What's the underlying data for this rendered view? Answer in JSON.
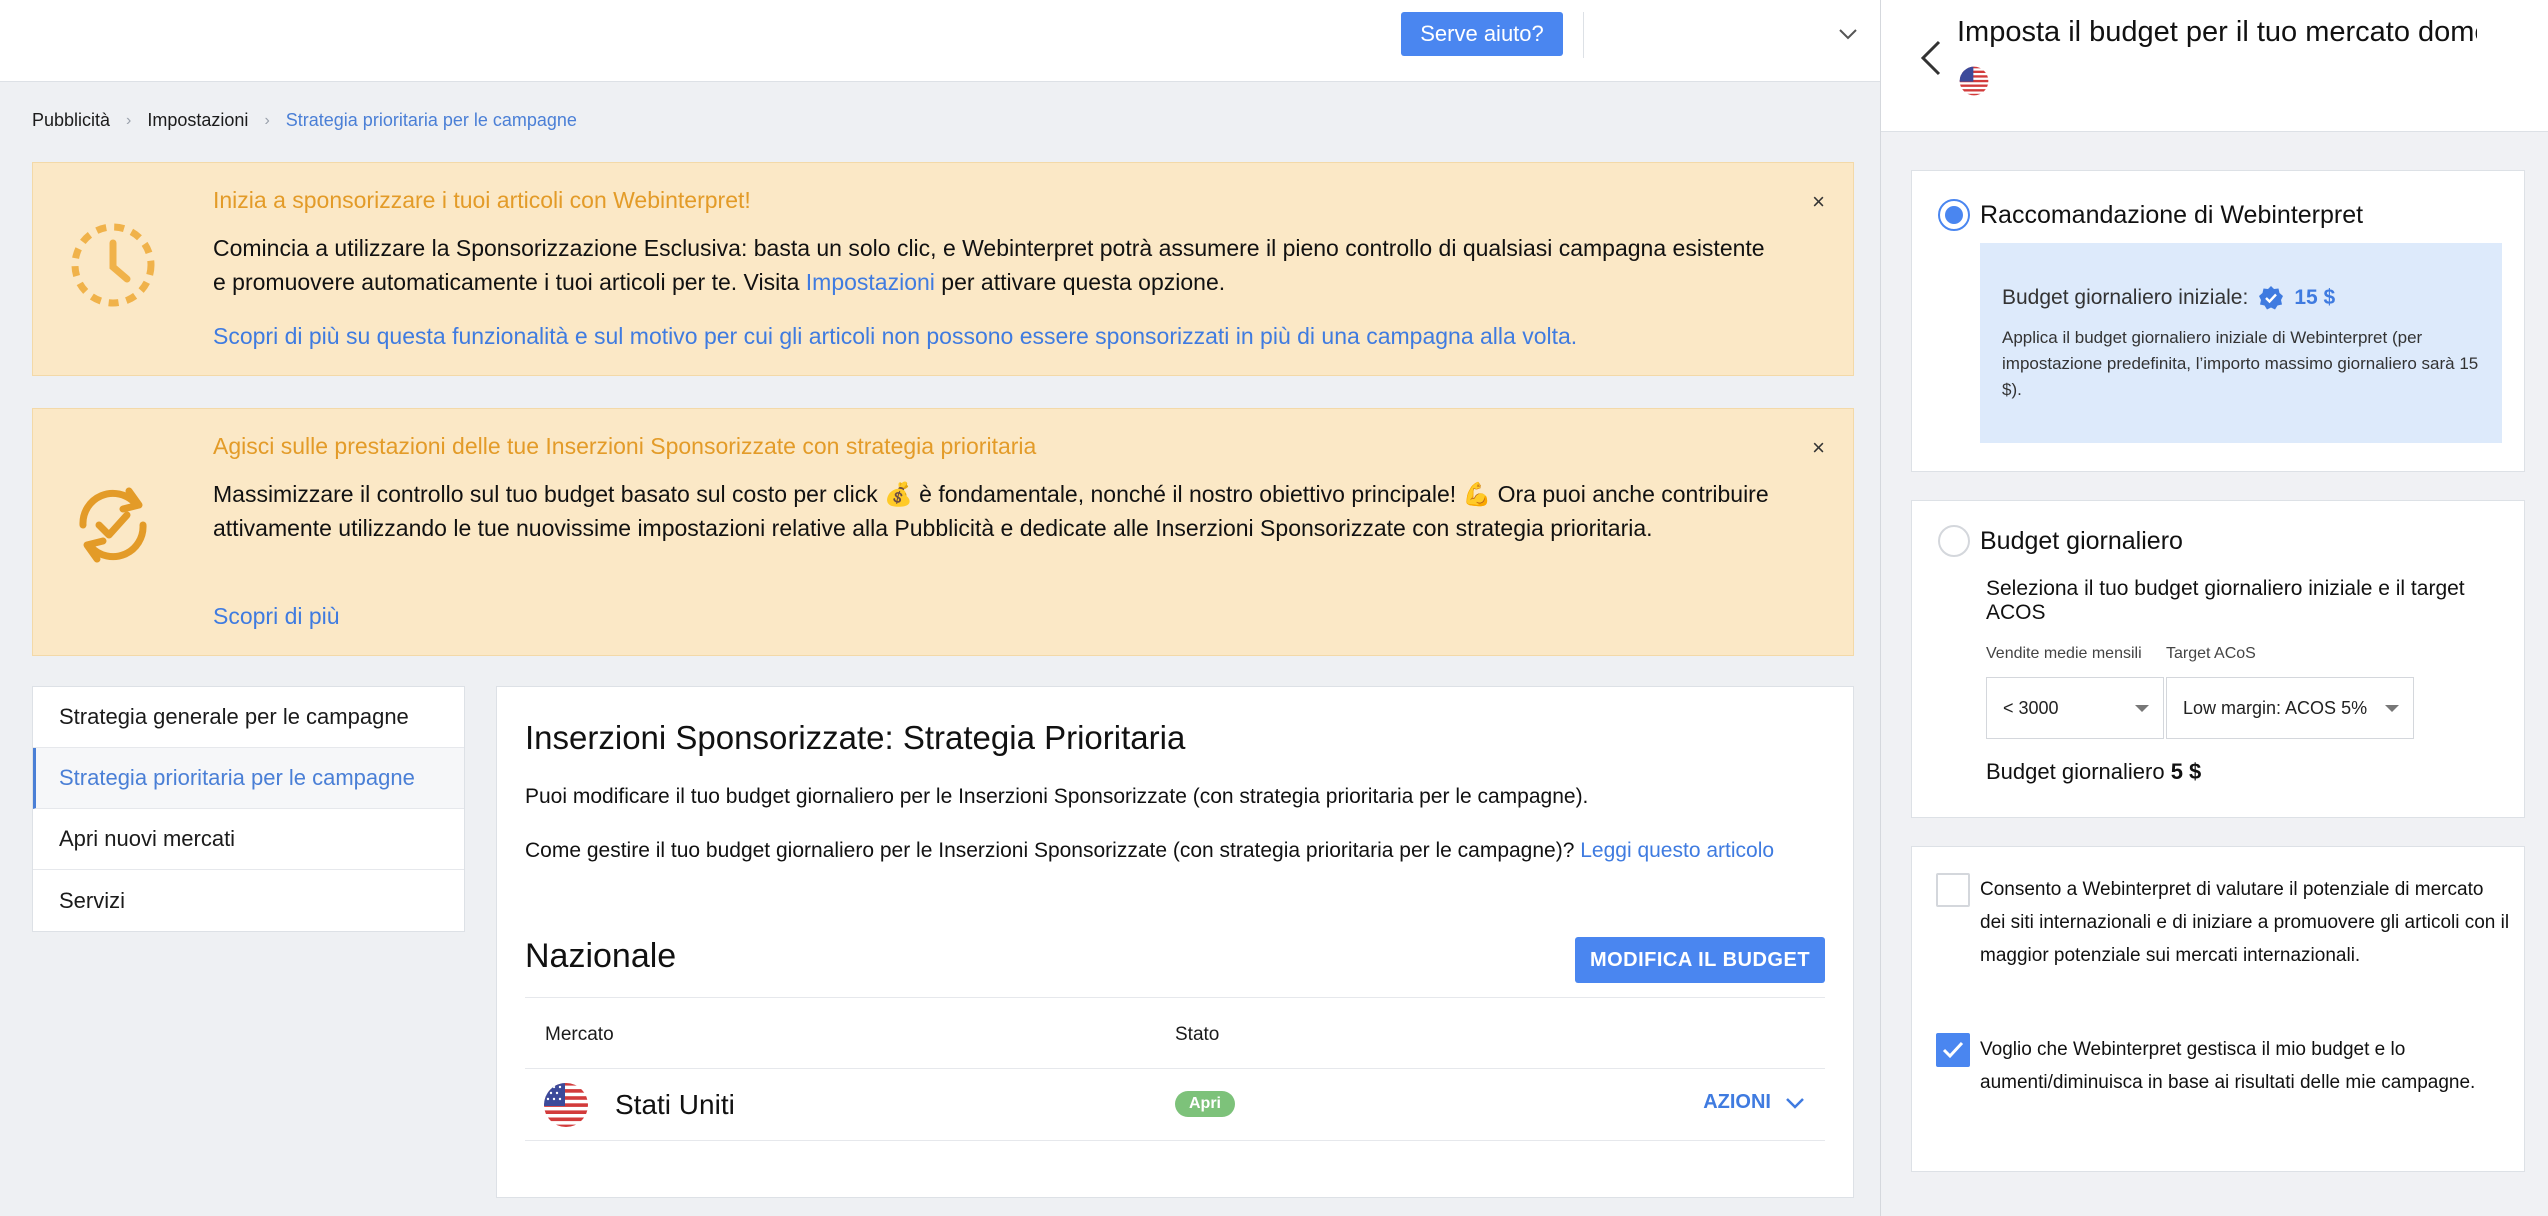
{
  "topbar": {
    "help_label": "Serve aiuto?"
  },
  "breadcrumb": [
    "Pubblicità",
    "Impostazioni",
    "Strategia prioritaria per le campagne"
  ],
  "banner1": {
    "title": "Inizia a sponsorizzare i tuoi articoli con Webinterpret!",
    "body_pre": "Comincia a utilizzare la Sponsorizzazione Esclusiva: basta un solo clic, e Webinterpret potrà assumere il pieno controllo di qualsiasi campagna esistente e promuovere automaticamente i tuoi articoli per te. Visita ",
    "body_link": "Impostazioni",
    "body_post": " per attivare questa opzione.",
    "more": "Scopri di più su questa funzionalità e sul motivo per cui gli articoli non possono essere sponsorizzati in più di una campagna alla volta.",
    "close": "×"
  },
  "banner2": {
    "title": "Agisci sulle prestazioni delle tue Inserzioni Sponsorizzate con strategia prioritaria",
    "body": "Massimizzare il controllo sul tuo budget basato sul costo per click 💰 è fondamentale, nonché il nostro obiettivo principale! 💪 Ora puoi anche contribuire attivamente utilizzando le tue nuovissime impostazioni relative alla Pubblicità e dedicate alle Inserzioni Sponsorizzate con strategia prioritaria.",
    "more": "Scopri di più",
    "close": "×"
  },
  "leftnav": [
    "Strategia generale per le campagne",
    "Strategia prioritaria per le campagne",
    "Apri nuovi mercati",
    "Servizi"
  ],
  "main": {
    "title": "Inserzioni Sponsorizzate: Strategia Prioritaria",
    "p1": "Puoi modificare il tuo budget giornaliero per le Inserzioni Sponsorizzate (con strategia prioritaria per le campagne).",
    "p2": "Come gestire il tuo budget giornaliero per le Inserzioni Sponsorizzate (con strategia prioritaria per le campagne)? ",
    "p2_link": "Leggi questo articolo",
    "section": "Nazionale",
    "edit_button": "MODIFICA IL BUDGET",
    "table": {
      "headers": [
        "Mercato",
        "Stato"
      ],
      "rows": [
        {
          "market": "Stati Uniti",
          "status": "Apri",
          "actions": "AZIONI"
        }
      ]
    }
  },
  "panel": {
    "title": "Imposta il budget per il tuo mercato dome",
    "reco": {
      "label": "Raccomandazione di Webinterpret",
      "budget_label": "Budget giornaliero iniziale:",
      "budget_value": "15 $",
      "text": "Applica il budget giornaliero iniziale di Webinterpret (per impostazione predefinita, l’importo massimo giornaliero sarà 15 $)."
    },
    "daily": {
      "label": "Budget giornaliero",
      "desc": "Seleziona il tuo budget giornaliero iniziale e il target ACOS",
      "sales_label": "Vendite medie mensili",
      "acos_label": "Target ACoS",
      "sales_value": "< 3000",
      "acos_value": "Low margin: ACOS 5%",
      "total_label": "Budget giornaliero ",
      "total_value": "5 $"
    },
    "consent": {
      "opt1": "Consento a Webinterpret di valutare il potenziale di mercato dei siti internazionali e di iniziare a promuovere gli articoli con il maggior potenziale sui mercati internazionali.",
      "opt2": "Voglio che Webinterpret gestisca il mio budget e lo aumenti/diminuisca in base ai risultati delle mie campagne."
    }
  },
  "colors": {
    "accent": "#4a86f0",
    "banner_bg": "#fbe8c6",
    "banner_title": "#e39b28",
    "badge_green": "#7dc27a"
  },
  "icons": [
    "chevron-down-icon",
    "clock-icon",
    "refresh-check-icon",
    "close-icon",
    "us-flag-icon",
    "back-arrow-icon",
    "verified-badge-icon",
    "check-icon"
  ]
}
